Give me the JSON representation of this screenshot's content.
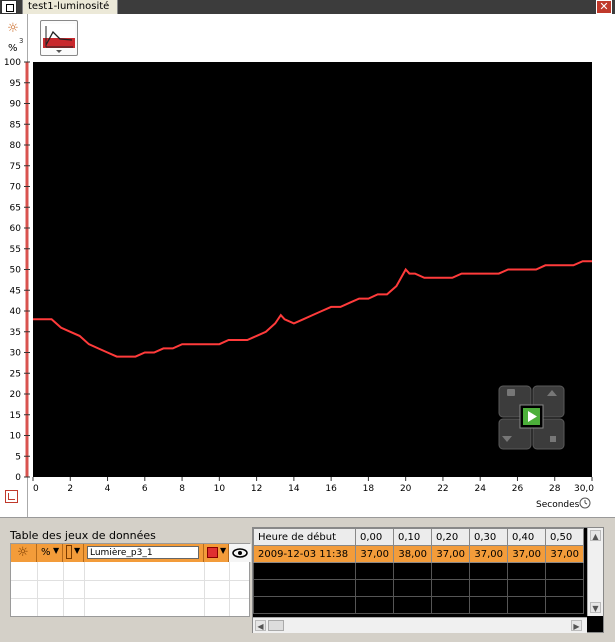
{
  "window": {
    "tab_title": "test1-luminosité",
    "close_symbol": "✕"
  },
  "sensor": {
    "unit": "%",
    "port": "3",
    "icon": "light-sensor-icon"
  },
  "chart_data": {
    "type": "line",
    "xlabel": "Secondes",
    "ylabel": "%",
    "xlim": [
      0,
      30
    ],
    "ylim": [
      0,
      100
    ],
    "x_ticks": [
      "0",
      "2",
      "4",
      "6",
      "8",
      "10",
      "12",
      "14",
      "16",
      "18",
      "20",
      "22",
      "24",
      "26",
      "28",
      "30,0"
    ],
    "y_ticks": [
      "0",
      "5",
      "10",
      "15",
      "20",
      "25",
      "30",
      "35",
      "40",
      "45",
      "50",
      "55",
      "60",
      "65",
      "70",
      "75",
      "80",
      "85",
      "90",
      "95",
      "100"
    ],
    "background": "#000000",
    "line_color": "#ff3b3b",
    "series": [
      {
        "x": [
          0,
          0.5,
          1,
          1.5,
          2,
          2.5,
          3,
          3.5,
          4,
          4.5,
          5,
          5.5,
          6,
          6.5,
          7,
          7.5,
          8,
          8.5,
          9,
          9.5,
          10,
          10.5,
          11,
          11.5,
          12,
          12.5,
          13,
          13.3,
          13.5,
          14,
          14.5,
          15,
          15.5,
          16,
          16.5,
          17,
          17.5,
          18,
          18.5,
          19,
          19.5,
          20,
          20.2,
          20.5,
          21,
          21.5,
          22,
          22.5,
          23,
          23.5,
          24,
          24.5,
          25,
          25.5,
          26,
          26.5,
          27,
          27.5,
          28,
          28.5,
          29,
          29.5,
          30
        ],
        "y": [
          38,
          38,
          38,
          36,
          35,
          34,
          32,
          31,
          30,
          29,
          29,
          29,
          30,
          30,
          31,
          31,
          32,
          32,
          32,
          32,
          32,
          33,
          33,
          33,
          34,
          35,
          37,
          39,
          38,
          37,
          38,
          39,
          40,
          41,
          41,
          42,
          43,
          43,
          44,
          44,
          46,
          50,
          49,
          49,
          48,
          48,
          48,
          48,
          49,
          49,
          49,
          49,
          49,
          50,
          50,
          50,
          50,
          51,
          51,
          51,
          51,
          52,
          52
        ]
      }
    ]
  },
  "datasets_table": {
    "title": "Table des jeux de données",
    "row": {
      "unit": "%",
      "name": "Lumière_p3_1",
      "color": "#e03030"
    }
  },
  "data_table": {
    "headers": [
      "Heure de début",
      "0,00",
      "0,10",
      "0,20",
      "0,30",
      "0,40",
      "0,50"
    ],
    "rows": [
      [
        "2009-12-03 11:38",
        "37,00",
        "38,00",
        "37,00",
        "37,00",
        "37,00",
        "37,00"
      ]
    ]
  }
}
